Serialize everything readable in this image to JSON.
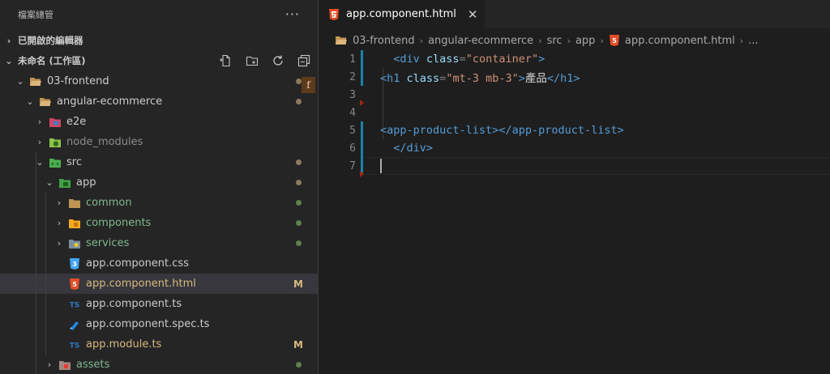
{
  "explorer": {
    "title": "檔案總管",
    "more": "···",
    "open_editors": "已開啟的編輯器",
    "workspace": "未命名 (工作區)",
    "tree": [
      {
        "label": "03-frontend",
        "color": "white",
        "twist": "⌄",
        "deco": "dot-brown",
        "icon": "folder-open-icon"
      },
      {
        "label": "angular-ecommerce",
        "color": "white",
        "twist": "⌄",
        "deco": "dot-brown",
        "icon": "folder-open-icon"
      },
      {
        "label": "e2e",
        "color": "white",
        "twist": "›",
        "deco": "",
        "icon": "e2e-folder-icon"
      },
      {
        "label": "node_modules",
        "color": "gray",
        "twist": "›",
        "deco": "",
        "icon": "node-folder-icon"
      },
      {
        "label": "src",
        "color": "white",
        "twist": "⌄",
        "deco": "dot-brown",
        "icon": "src-folder-icon"
      },
      {
        "label": "app",
        "color": "white",
        "twist": "⌄",
        "deco": "dot-brown",
        "icon": "app-folder-icon"
      },
      {
        "label": "common",
        "color": "green",
        "twist": "›",
        "deco": "dot-green",
        "icon": "folder-icon"
      },
      {
        "label": "components",
        "color": "green",
        "twist": "›",
        "deco": "dot-green",
        "icon": "components-folder-icon"
      },
      {
        "label": "services",
        "color": "green",
        "twist": "›",
        "deco": "dot-green",
        "icon": "services-folder-icon"
      },
      {
        "label": "app.component.css",
        "color": "white",
        "twist": "",
        "deco": "",
        "icon": "css-file-icon"
      },
      {
        "label": "app.component.html",
        "color": "mod",
        "twist": "",
        "deco": "M",
        "icon": "html-file-icon"
      },
      {
        "label": "app.component.ts",
        "color": "white",
        "twist": "",
        "deco": "",
        "icon": "ts-file-icon"
      },
      {
        "label": "app.component.spec.ts",
        "color": "white",
        "twist": "",
        "deco": "",
        "icon": "spec-file-icon"
      },
      {
        "label": "app.module.ts",
        "color": "mod",
        "twist": "",
        "deco": "M",
        "icon": "ts-file-icon"
      },
      {
        "label": "assets",
        "color": "green",
        "twist": "›",
        "deco": "dot-green",
        "icon": "assets-folder-icon"
      }
    ],
    "side_badge": "f"
  },
  "editor": {
    "tab_label": "app.component.html",
    "tab_close": "✕",
    "breadcrumbs": [
      "03-frontend",
      "angular-ecommerce",
      "src",
      "app",
      "app.component.html",
      "..."
    ],
    "line_numbers": [
      "1",
      "2",
      "3",
      "4",
      "5",
      "6",
      "7"
    ],
    "lines": [
      {
        "indent": "  ",
        "open": "<div",
        "attr": "class",
        "eq": "=",
        "str": "\"container\"",
        "close": ">",
        "text": "",
        "end": ""
      },
      {
        "indent": "",
        "open": "<h1",
        "attr": "class",
        "eq": "=",
        "str": "\"mt-3 mb-3\"",
        "close": ">",
        "text": "產品",
        "end": "</h1>"
      },
      {
        "indent": "",
        "open": "",
        "attr": "",
        "eq": "",
        "str": "",
        "close": "",
        "text": "",
        "end": ""
      },
      {
        "indent": "",
        "open": "",
        "attr": "",
        "eq": "",
        "str": "",
        "close": "",
        "text": "",
        "end": ""
      },
      {
        "indent": "",
        "open": "<app-product-list>",
        "attr": "",
        "eq": "",
        "str": "",
        "close": "",
        "text": "",
        "end": "</app-product-list>"
      },
      {
        "indent": "  ",
        "open": "</div>",
        "attr": "",
        "eq": "",
        "str": "",
        "close": "",
        "text": "",
        "end": ""
      },
      {
        "indent": "",
        "open": "",
        "attr": "",
        "eq": "",
        "str": "",
        "close": "",
        "text": "",
        "end": ""
      }
    ]
  },
  "colors": {
    "sidebar_bg": "#252526",
    "editor_bg": "#1e1e1e",
    "modified": "#d7ba7d",
    "untracked_green": "#81b88b",
    "html_orange": "#e44d26",
    "ts_blue": "#3178c6"
  }
}
